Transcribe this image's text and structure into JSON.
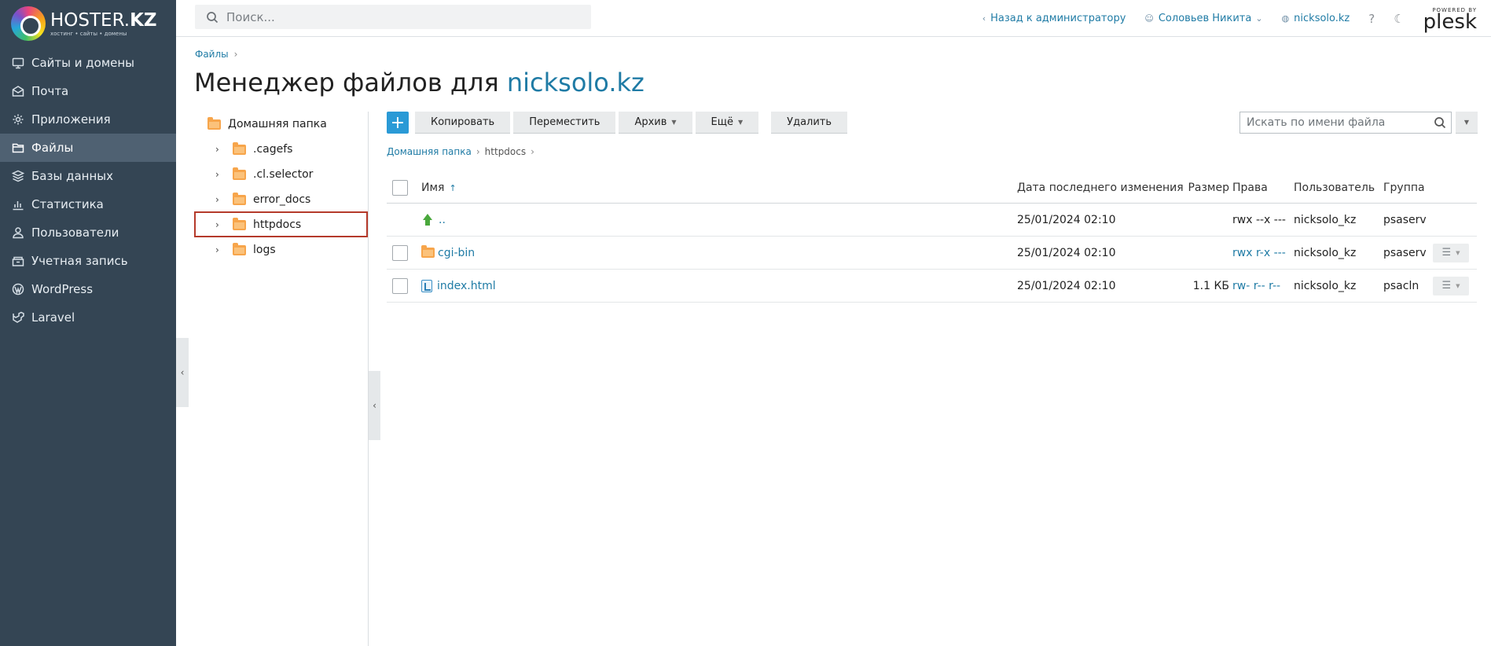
{
  "brand": {
    "name_light": "HOSTER.",
    "name_bold": "KZ",
    "tagline": "хостинг • сайты • домены"
  },
  "sidebar": {
    "items": [
      {
        "label": "Сайты и домены",
        "icon": "monitor-icon"
      },
      {
        "label": "Почта",
        "icon": "mail-icon"
      },
      {
        "label": "Приложения",
        "icon": "gear-icon"
      },
      {
        "label": "Файлы",
        "icon": "files-icon",
        "active": true
      },
      {
        "label": "Базы данных",
        "icon": "database-icon"
      },
      {
        "label": "Статистика",
        "icon": "chart-icon"
      },
      {
        "label": "Пользователи",
        "icon": "user-icon"
      },
      {
        "label": "Учетная запись",
        "icon": "account-icon"
      },
      {
        "label": "WordPress",
        "icon": "wordpress-icon"
      },
      {
        "label": "Laravel",
        "icon": "laravel-icon"
      }
    ]
  },
  "topbar": {
    "search_placeholder": "Поиск...",
    "back_link": "Назад к администратору",
    "user": "Соловьев Никита",
    "domain": "nicksolo.kz",
    "plesk_small": "POWERED BY",
    "plesk_big": "plesk"
  },
  "page": {
    "breadcrumb": "Файлы",
    "title_prefix": "Менеджер файлов для",
    "title_domain": "nicksolo.kz"
  },
  "tree": {
    "root": "Домашняя папка",
    "children": [
      ".cagefs",
      ".cl.selector",
      "error_docs",
      "httpdocs",
      "logs"
    ]
  },
  "toolbar": {
    "add": "+",
    "copy": "Копировать",
    "move": "Переместить",
    "archive": "Архив",
    "more": "Ещё",
    "delete": "Удалить",
    "file_search_placeholder": "Искать по имени файла"
  },
  "path": {
    "home": "Домашняя папка",
    "current": "httpdocs"
  },
  "table": {
    "headers": {
      "name": "Имя",
      "date": "Дата последнего изменения",
      "size": "Размер",
      "perms": "Права",
      "user": "Пользователь",
      "group": "Группа"
    },
    "rows": [
      {
        "name": "..",
        "date": "25/01/2024 02:10",
        "size": "",
        "perms": "rwx --x ---",
        "user": "nicksolo_kz",
        "group": "psaserv"
      },
      {
        "name": "cgi-bin",
        "date": "25/01/2024 02:10",
        "size": "",
        "perms": "rwx r-x ---",
        "user": "nicksolo_kz",
        "group": "psaserv"
      },
      {
        "name": "index.html",
        "date": "25/01/2024 02:10",
        "size": "1.1 КБ",
        "perms": "rw- r-- r--",
        "user": "nicksolo_kz",
        "group": "psacln"
      }
    ]
  }
}
